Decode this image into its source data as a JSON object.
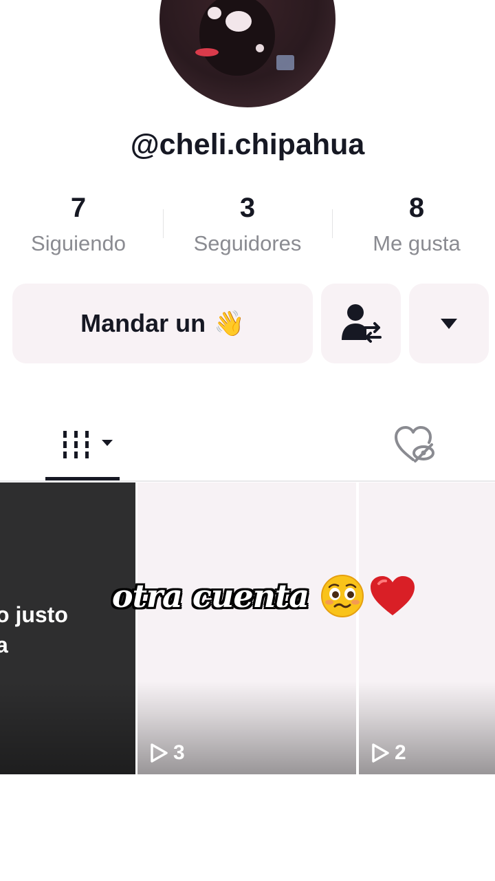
{
  "profile": {
    "username": "@cheli.chipahua"
  },
  "stats": [
    {
      "value": "7",
      "label": "Siguiendo"
    },
    {
      "value": "3",
      "label": "Seguidores"
    },
    {
      "value": "8",
      "label": "Me gusta"
    }
  ],
  "actions": {
    "message_label": "Mandar un",
    "wave_emoji": "👋"
  },
  "tabs": {
    "videos_icon": "grid-icon",
    "liked_icon": "hidden-heart-icon"
  },
  "videos": [
    {
      "caption": "o justo\na",
      "views": ""
    },
    {
      "caption": "",
      "views": "3"
    },
    {
      "caption": "",
      "views": "2"
    }
  ],
  "overlay": {
    "text": "otra cuenta",
    "emojis": [
      "pleading-face-icon",
      "red-heart-icon"
    ]
  },
  "colors": {
    "text": "#161823",
    "muted": "#8a8b91",
    "button_bg": "#f8f2f5",
    "heart": "#d91f26"
  }
}
